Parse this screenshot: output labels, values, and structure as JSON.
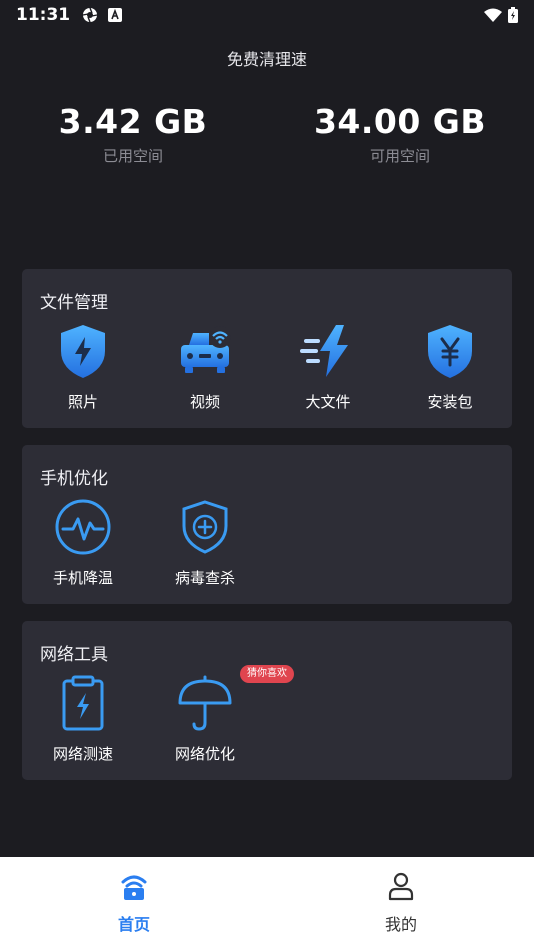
{
  "status_bar": {
    "time": "11:31",
    "left_icons": [
      "aperture-icon",
      "a-badge-icon"
    ],
    "right_icons": [
      "wifi-icon",
      "battery-charging-icon"
    ]
  },
  "header": {
    "title": "免费清理速"
  },
  "storage": {
    "used_value": "3.42 GB",
    "used_label": "已用空间",
    "free_value": "34.00 GB",
    "free_label": "可用空间"
  },
  "sections": {
    "files": {
      "title": "文件管理",
      "items": [
        {
          "label": "照片",
          "icon": "shield-bolt-icon"
        },
        {
          "label": "视频",
          "icon": "car-wifi-icon"
        },
        {
          "label": "大文件",
          "icon": "fast-bolt-icon"
        },
        {
          "label": "安装包",
          "icon": "shield-yen-icon"
        }
      ]
    },
    "phone": {
      "title": "手机优化",
      "items": [
        {
          "label": "手机降温",
          "icon": "pulse-circle-icon"
        },
        {
          "label": "病毒查杀",
          "icon": "shield-plus-icon"
        }
      ]
    },
    "network": {
      "title": "网络工具",
      "badge": "猜你喜欢",
      "items": [
        {
          "label": "网络测速",
          "icon": "clipboard-bolt-icon"
        },
        {
          "label": "网络优化",
          "icon": "umbrella-icon"
        }
      ]
    }
  },
  "bottom_nav": {
    "items": [
      {
        "label": "首页",
        "icon": "wifi-home-icon",
        "active": true
      },
      {
        "label": "我的",
        "icon": "person-icon",
        "active": false
      }
    ]
  },
  "colors": {
    "background": "#1c1c21",
    "card": "#2d2d36",
    "accent": "#2a7ef0",
    "icon_blue": "#3a9bf2",
    "badge": "#e0454f"
  }
}
